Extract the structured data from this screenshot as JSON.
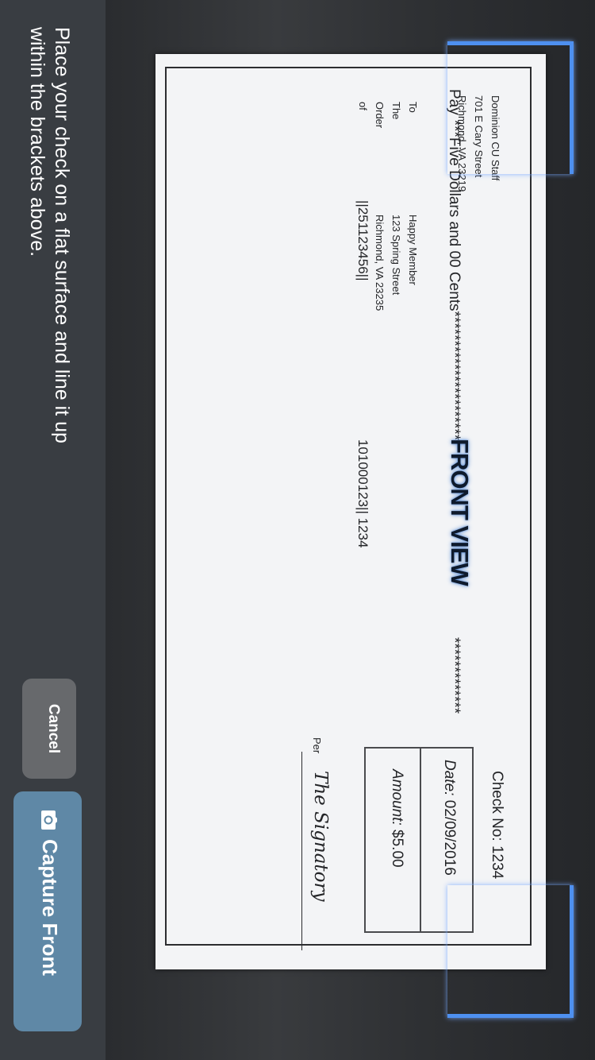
{
  "instructions": "Place your check on a flat surface and line it up within the brackets above.",
  "buttons": {
    "cancel": "Cancel",
    "capture": "Capture Front"
  },
  "icons": {
    "capture": "camera-icon"
  },
  "colors": {
    "panel": "#393d42",
    "capture_button": "#5f88a6",
    "cancel_button": "#67696c",
    "bracket": "#4e90f0"
  },
  "check": {
    "bank_lines": [
      "Dominion CU Staff",
      "701 E Cary Street",
      "Richmond, VA 23219"
    ],
    "pay_label": "Pay",
    "pay_amount_words": "***Five Dollars and 00 Cents**********************",
    "overlay_label": "FRONT VIEW",
    "pay_tail": "*************",
    "to_order_lines": [
      "To",
      "The",
      "Order",
      "of"
    ],
    "payee_lines": [
      "Happy Member",
      "123 Spring Street",
      "Richmond, VA 23235"
    ],
    "account_number": "||251123456||",
    "routing_number": "101000123|| 1234",
    "check_no_label": "Check No:",
    "check_no": "1234",
    "date_label": "Date:",
    "date": "02/09/2016",
    "amount_label": "Amount:",
    "amount": "$5.00",
    "per_label": "Per",
    "signature": "The Signatory"
  }
}
